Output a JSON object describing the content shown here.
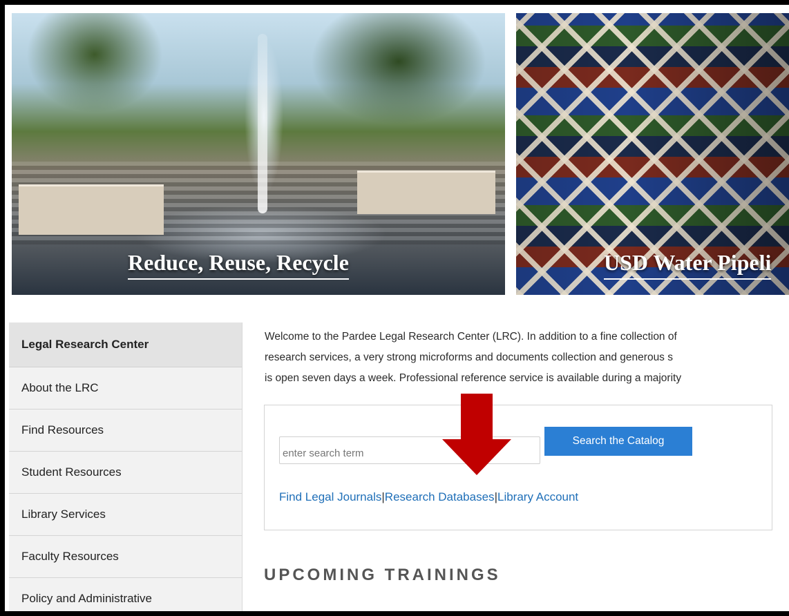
{
  "hero": [
    {
      "caption": "Reduce, Reuse, Recycle"
    },
    {
      "caption": "USD Water Pipeli"
    }
  ],
  "sidebar": {
    "header": "Legal Research Center",
    "items": [
      {
        "label": "About the LRC"
      },
      {
        "label": "Find Resources"
      },
      {
        "label": "Student Resources"
      },
      {
        "label": "Library Services"
      },
      {
        "label": "Faculty Resources"
      },
      {
        "label": "Policy and Administrative"
      }
    ]
  },
  "intro": {
    "lines": [
      "Welcome to the Pardee Legal Research Center (LRC).  In addition to a fine collection of",
      "research services, a very strong microforms and documents collection and generous s",
      "is open seven days a week. Professional reference service is available during a majority"
    ]
  },
  "search": {
    "placeholder": "enter search term",
    "value": "",
    "button_label": "Search the Catalog",
    "links": [
      {
        "label": "Find Legal Journals"
      },
      {
        "label": "Research Databases"
      },
      {
        "label": "Library Account"
      }
    ],
    "separator": "|"
  },
  "upcoming": {
    "heading": "UPCOMING TRAININGS"
  },
  "colors": {
    "accent_blue": "#2b7fd4",
    "link_blue": "#1f6fb8",
    "annotation_red": "#c00000",
    "frame": "#000000"
  },
  "icons": {
    "annotation": "arrow-down-icon"
  }
}
